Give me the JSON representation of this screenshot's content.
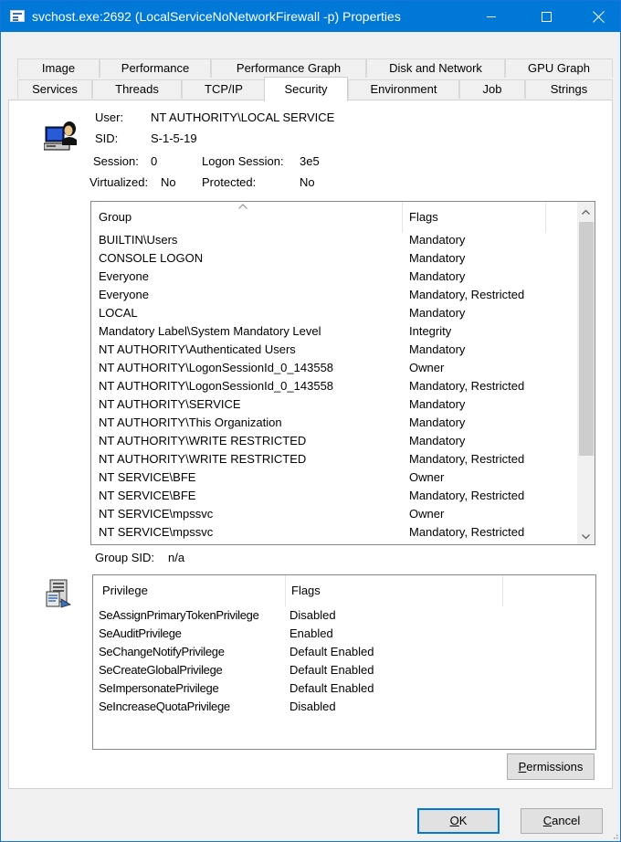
{
  "window": {
    "title": "svchost.exe:2692 (LocalServiceNoNetworkFirewall -p) Properties"
  },
  "tabs": {
    "row_back": [
      "Image",
      "Performance",
      "Performance Graph",
      "Disk and Network",
      "GPU Graph"
    ],
    "row_front": [
      "Services",
      "Threads",
      "TCP/IP",
      "Security",
      "Environment",
      "Job",
      "Strings"
    ],
    "active": "Security"
  },
  "token": {
    "user_label": "User:",
    "user_value": "NT AUTHORITY\\LOCAL SERVICE",
    "sid_label": "SID:",
    "sid_value": "S-1-5-19",
    "session_label": "Session:",
    "session_value": "0",
    "logon_session_label": "Logon Session:",
    "logon_session_value": "3e5",
    "virtualized_label": "Virtualized:",
    "virtualized_value": "No",
    "protected_label": "Protected:",
    "protected_value": "No"
  },
  "groups": {
    "columns": [
      "Group",
      "Flags"
    ],
    "rows": [
      {
        "group": "BUILTIN\\Users",
        "flags": "Mandatory"
      },
      {
        "group": "CONSOLE LOGON",
        "flags": "Mandatory"
      },
      {
        "group": "Everyone",
        "flags": "Mandatory"
      },
      {
        "group": "Everyone",
        "flags": "Mandatory, Restricted"
      },
      {
        "group": "LOCAL",
        "flags": "Mandatory"
      },
      {
        "group": "Mandatory Label\\System Mandatory Level",
        "flags": "Integrity"
      },
      {
        "group": "NT AUTHORITY\\Authenticated Users",
        "flags": "Mandatory"
      },
      {
        "group": "NT AUTHORITY\\LogonSessionId_0_143558",
        "flags": "Owner"
      },
      {
        "group": "NT AUTHORITY\\LogonSessionId_0_143558",
        "flags": "Mandatory, Restricted"
      },
      {
        "group": "NT AUTHORITY\\SERVICE",
        "flags": "Mandatory"
      },
      {
        "group": "NT AUTHORITY\\This Organization",
        "flags": "Mandatory"
      },
      {
        "group": "NT AUTHORITY\\WRITE RESTRICTED",
        "flags": "Mandatory"
      },
      {
        "group": "NT AUTHORITY\\WRITE RESTRICTED",
        "flags": "Mandatory, Restricted"
      },
      {
        "group": "NT SERVICE\\BFE",
        "flags": "Owner"
      },
      {
        "group": "NT SERVICE\\BFE",
        "flags": "Mandatory, Restricted"
      },
      {
        "group": "NT SERVICE\\mpssvc",
        "flags": "Owner"
      },
      {
        "group": "NT SERVICE\\mpssvc",
        "flags": "Mandatory, Restricted"
      }
    ],
    "group_sid_label": "Group SID:",
    "group_sid_value": "n/a"
  },
  "privileges": {
    "columns": [
      "Privilege",
      "Flags"
    ],
    "rows": [
      {
        "privilege": "SeAssignPrimaryTokenPrivilege",
        "flags": "Disabled"
      },
      {
        "privilege": "SeAuditPrivilege",
        "flags": "Enabled"
      },
      {
        "privilege": "SeChangeNotifyPrivilege",
        "flags": "Default Enabled"
      },
      {
        "privilege": "SeCreateGlobalPrivilege",
        "flags": "Default Enabled"
      },
      {
        "privilege": "SeImpersonatePrivilege",
        "flags": "Default Enabled"
      },
      {
        "privilege": "SeIncreaseQuotaPrivilege",
        "flags": "Disabled"
      }
    ]
  },
  "buttons": {
    "permissions": "Permissions",
    "ok": "OK",
    "cancel": "Cancel"
  },
  "colors": {
    "titlebar": "#0078d7",
    "scroll_thumb": "#cdcdcd"
  }
}
